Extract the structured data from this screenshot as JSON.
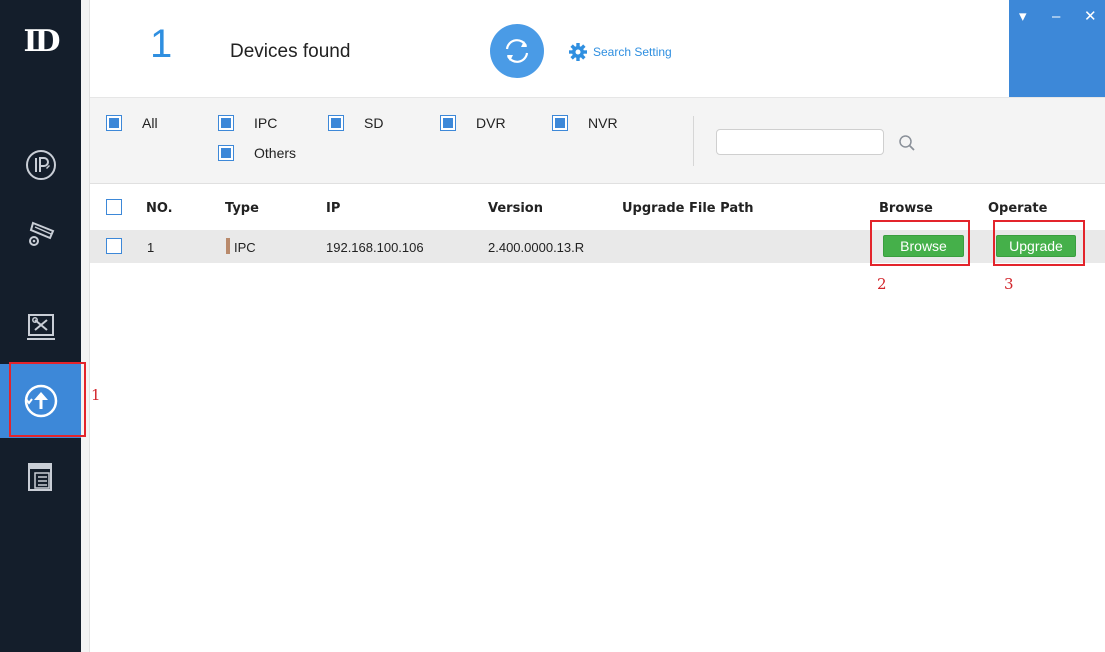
{
  "sidebar": {
    "logo": "ID",
    "items": [
      {
        "name": "ip",
        "icon": "ip-config-icon"
      },
      {
        "name": "device-config",
        "icon": "camera-gear-icon"
      },
      {
        "name": "system-settings",
        "icon": "tools-icon"
      },
      {
        "name": "system-upgrade",
        "icon": "upgrade-icon",
        "active": true
      },
      {
        "name": "documents",
        "icon": "document-icon"
      }
    ]
  },
  "header": {
    "count": "1",
    "found_label": "Devices found",
    "search_setting": "Search Setting",
    "window_controls": {
      "menu": "▾",
      "minimize": "–",
      "close": "✕"
    }
  },
  "filters": {
    "items": [
      {
        "label": "All",
        "checked": true
      },
      {
        "label": "IPC",
        "checked": true
      },
      {
        "label": "SD",
        "checked": true
      },
      {
        "label": "DVR",
        "checked": true
      },
      {
        "label": "NVR",
        "checked": true
      },
      {
        "label": "Others",
        "checked": true
      }
    ],
    "search_value": ""
  },
  "table": {
    "columns": [
      "NO.",
      "Type",
      "IP",
      "Version",
      "Upgrade File Path",
      "Browse",
      "Operate"
    ],
    "rows": [
      {
        "no": "1",
        "type": "IPC",
        "ip": "192.168.100.106",
        "version": "2.400.0000.13.R",
        "path": "",
        "browse": "Browse",
        "operate": "Upgrade"
      }
    ]
  },
  "annotations": [
    "1",
    "2",
    "3"
  ],
  "colors": {
    "sidebar_bg": "#141e2b",
    "accent_blue": "#3d88d8",
    "count_blue": "#2f8fe0",
    "button_green": "#45b04a",
    "annotation_red": "#e3242b"
  }
}
